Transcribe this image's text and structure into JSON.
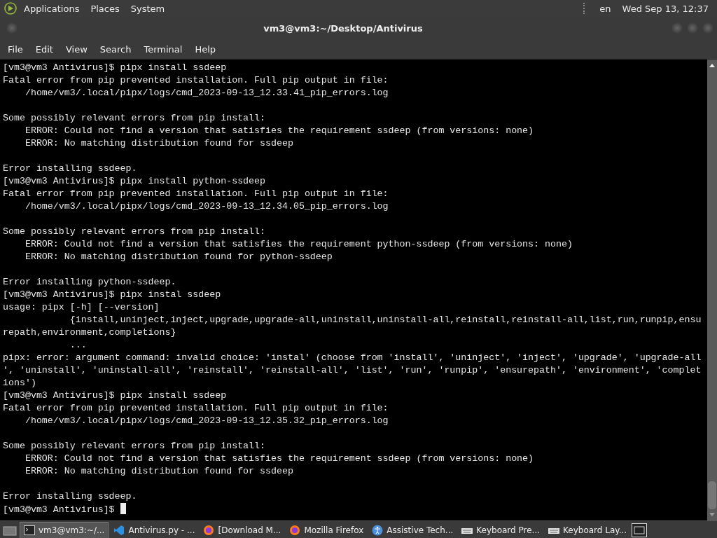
{
  "top_panel": {
    "menus": [
      "Applications",
      "Places",
      "System"
    ],
    "keyboard_layout": "en",
    "clock": "Wed Sep 13, 12:37"
  },
  "window": {
    "title": "vm3@vm3:~/Desktop/Antivirus"
  },
  "menu_bar": [
    "File",
    "Edit",
    "View",
    "Search",
    "Terminal",
    "Help"
  ],
  "terminal": {
    "lines": [
      {
        "kind": "text",
        "text": "[vm3@vm3 Antivirus]$ pipx install ssdeep"
      },
      {
        "kind": "text",
        "text": "Fatal error from pip prevented installation. Full pip output in file:"
      },
      {
        "kind": "text",
        "text": "    /home/vm3/.local/pipx/logs/cmd_2023-09-13_12.33.41_pip_errors.log"
      },
      {
        "kind": "blank"
      },
      {
        "kind": "text",
        "text": "Some possibly relevant errors from pip install:"
      },
      {
        "kind": "text",
        "text": "    ERROR: Could not find a version that satisfies the requirement ssdeep (from versions: none)"
      },
      {
        "kind": "text",
        "text": "    ERROR: No matching distribution found for ssdeep"
      },
      {
        "kind": "blank"
      },
      {
        "kind": "text",
        "text": "Error installing ssdeep."
      },
      {
        "kind": "text",
        "text": "[vm3@vm3 Antivirus]$ pipx install python-ssdeep"
      },
      {
        "kind": "text",
        "text": "Fatal error from pip prevented installation. Full pip output in file:"
      },
      {
        "kind": "text",
        "text": "    /home/vm3/.local/pipx/logs/cmd_2023-09-13_12.34.05_pip_errors.log"
      },
      {
        "kind": "blank"
      },
      {
        "kind": "text",
        "text": "Some possibly relevant errors from pip install:"
      },
      {
        "kind": "text",
        "text": "    ERROR: Could not find a version that satisfies the requirement python-ssdeep (from versions: none)"
      },
      {
        "kind": "text",
        "text": "    ERROR: No matching distribution found for python-ssdeep"
      },
      {
        "kind": "blank"
      },
      {
        "kind": "text",
        "text": "Error installing python-ssdeep."
      },
      {
        "kind": "text",
        "text": "[vm3@vm3 Antivirus]$ pipx instal ssdeep"
      },
      {
        "kind": "text",
        "text": "usage: pipx [-h] [--version]"
      },
      {
        "kind": "text",
        "text": "            {install,uninject,inject,upgrade,upgrade-all,uninstall,uninstall-all,reinstall,reinstall-all,list,run,runpip,ensu"
      },
      {
        "kind": "text",
        "text": "repath,environment,completions}"
      },
      {
        "kind": "text",
        "text": "            ..."
      },
      {
        "kind": "text",
        "text": "pipx: error: argument command: invalid choice: 'instal' (choose from 'install', 'uninject', 'inject', 'upgrade', 'upgrade-all"
      },
      {
        "kind": "text",
        "text": "', 'uninstall', 'uninstall-all', 'reinstall', 'reinstall-all', 'list', 'run', 'runpip', 'ensurepath', 'environment', 'complet"
      },
      {
        "kind": "text",
        "text": "ions')"
      },
      {
        "kind": "text",
        "text": "[vm3@vm3 Antivirus]$ pipx install ssdeep"
      },
      {
        "kind": "text",
        "text": "Fatal error from pip prevented installation. Full pip output in file:"
      },
      {
        "kind": "text",
        "text": "    /home/vm3/.local/pipx/logs/cmd_2023-09-13_12.35.32_pip_errors.log"
      },
      {
        "kind": "blank"
      },
      {
        "kind": "text",
        "text": "Some possibly relevant errors from pip install:"
      },
      {
        "kind": "text",
        "text": "    ERROR: Could not find a version that satisfies the requirement ssdeep (from versions: none)"
      },
      {
        "kind": "text",
        "text": "    ERROR: No matching distribution found for ssdeep"
      },
      {
        "kind": "blank"
      },
      {
        "kind": "text",
        "text": "Error installing ssdeep."
      },
      {
        "kind": "prompt",
        "text": "[vm3@vm3 Antivirus]$ "
      }
    ]
  },
  "taskbar": {
    "tasks": [
      {
        "kind": "terminal",
        "label": "vm3@vm3:~/...",
        "selected": true
      },
      {
        "kind": "code",
        "label": "Antivirus.py - ...",
        "selected": false
      },
      {
        "kind": "firefox",
        "label": "[Download M...",
        "selected": false
      },
      {
        "kind": "firefox",
        "label": "Mozilla Firefox",
        "selected": false
      },
      {
        "kind": "accessibility",
        "label": "Assistive Tech...",
        "selected": false
      },
      {
        "kind": "keyboard",
        "label": "Keyboard Pre...",
        "selected": false
      },
      {
        "kind": "keyboard",
        "label": "Keyboard Lay...",
        "selected": false
      }
    ]
  }
}
